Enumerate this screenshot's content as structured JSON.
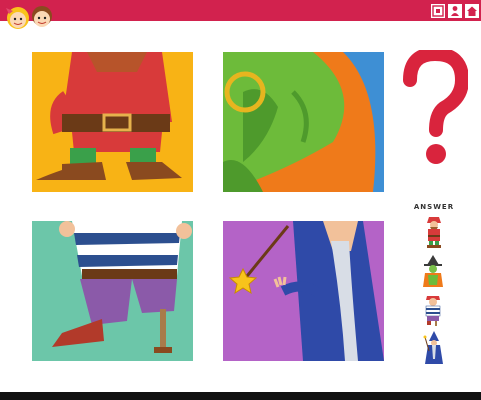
{
  "header": {
    "icons": [
      "kids-logo",
      "copy-icon",
      "person-icon",
      "home-icon"
    ],
    "accent": "#d2224e"
  },
  "puzzle": {
    "panels": [
      {
        "character": "dwarf",
        "bg": "#f8b315"
      },
      {
        "character": "witch",
        "bg": "#3e8fd4"
      },
      {
        "character": "pirate",
        "bg": "#6cc6a9"
      },
      {
        "character": "wizard",
        "bg": "#b463c7"
      }
    ]
  },
  "question": {
    "symbol": "?",
    "color": "#d9243d"
  },
  "answers": {
    "label": "ANSWER",
    "options": [
      "dwarf",
      "witch",
      "pirate",
      "wizard"
    ]
  }
}
